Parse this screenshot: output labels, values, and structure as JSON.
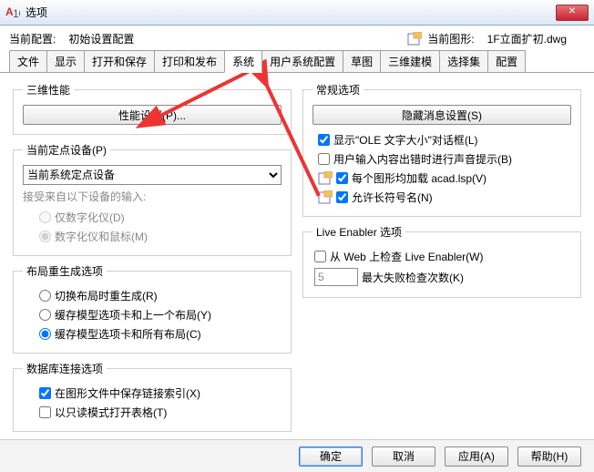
{
  "window": {
    "title": "选项"
  },
  "header": {
    "current_config_label": "当前配置:",
    "current_config_value": "初始设置配置",
    "current_drawing_label": "当前图形:",
    "current_drawing_value": "1F立面扩初.dwg"
  },
  "tabs": [
    "文件",
    "显示",
    "打开和保存",
    "打印和发布",
    "系统",
    "用户系统配置",
    "草图",
    "三维建模",
    "选择集",
    "配置"
  ],
  "active_tab_index": 4,
  "left": {
    "group_3d": {
      "title": "三维性能",
      "perf_button": "性能设置(P)..."
    },
    "group_pointing": {
      "title": "当前定点设备(P)",
      "combo_value": "当前系统定点设备",
      "accept_label": "接受来自以下设备的输入:",
      "opt_digitizer": "仅数字化仪(D)",
      "opt_both": "数字化仪和鼠标(M)"
    },
    "group_layout": {
      "title": "布局重生成选项",
      "opt_switch": "切换布局时重生成(R)",
      "opt_cache_last": "缓存模型选项卡和上一个布局(Y)",
      "opt_cache_all": "缓存模型选项卡和所有布局(C)"
    },
    "group_db": {
      "title": "数据库连接选项",
      "opt_save_index": "在图形文件中保存链接索引(X)",
      "opt_readonly": "以只读模式打开表格(T)"
    }
  },
  "right": {
    "group_general": {
      "title": "常规选项",
      "hide_msg_button": "隐藏消息设置(S)",
      "opt_ole": "显示\"OLE 文字大小\"对话框(L)",
      "opt_beep": "用户输入内容出错时进行声音提示(B)",
      "opt_acadlsp": "每个图形均加载 acad.lsp(V)",
      "opt_longnames": "允许长符号名(N)"
    },
    "group_live": {
      "title": "Live Enabler 选项",
      "opt_check_web": "从 Web 上检查 Live Enabler(W)",
      "fail_value": "5",
      "fail_label": "最大失败检查次数(K)"
    }
  },
  "footer": {
    "ok": "确定",
    "cancel": "取消",
    "apply": "应用(A)",
    "help": "帮助(H)"
  }
}
